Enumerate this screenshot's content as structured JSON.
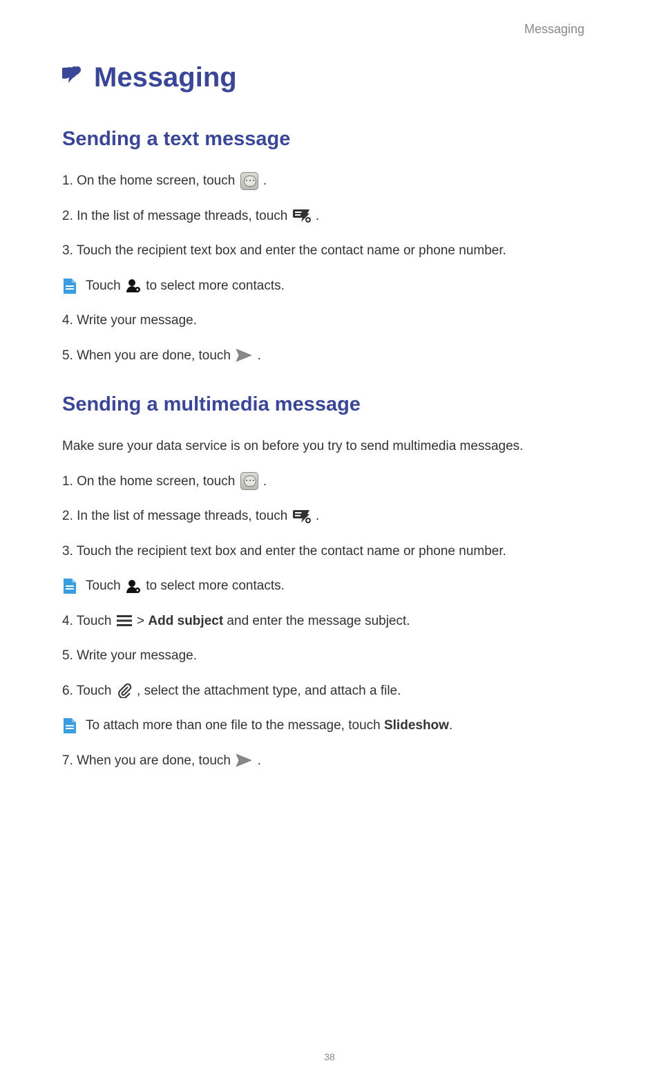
{
  "header": {
    "section_label": "Messaging"
  },
  "chapter": {
    "title": "Messaging"
  },
  "sections": [
    {
      "heading": "Sending a text message",
      "items": [
        {
          "num": "1. ",
          "before": "On the home screen, touch ",
          "icon": "messaging-app",
          "after": "."
        },
        {
          "num": "2. ",
          "before": "In the list of message threads, touch ",
          "icon": "compose-message",
          "after": "."
        },
        {
          "num": "3. ",
          "text": "Touch the recipient text box and enter the contact name or phone number."
        },
        {
          "tip": true,
          "before": "Touch ",
          "icon": "add-contact",
          "after": "to select more contacts."
        },
        {
          "num": "4. ",
          "text": "Write your message."
        },
        {
          "num": "5. ",
          "before": "When you are done, touch ",
          "icon": "send",
          "after": "."
        }
      ]
    },
    {
      "heading": "Sending a multimedia message",
      "intro": "Make sure your data service is on before you try to send multimedia messages.",
      "items": [
        {
          "num": "1. ",
          "before": "On the home screen, touch ",
          "icon": "messaging-app",
          "after": "."
        },
        {
          "num": "2. ",
          "before": "In the list of message threads, touch ",
          "icon": "compose-message",
          "after": "."
        },
        {
          "num": "3. ",
          "text": "Touch the recipient text box and enter the contact name or phone number."
        },
        {
          "tip": true,
          "before": "Touch ",
          "icon": "add-contact",
          "after": "to select more contacts."
        },
        {
          "num": "4. ",
          "before": "Touch ",
          "icon": "menu",
          "after_parts": [
            {
              "text": " > "
            },
            {
              "text": "Add subject",
              "bold": true
            },
            {
              "text": " and enter the message subject."
            }
          ]
        },
        {
          "num": "5. ",
          "text": "Write your message."
        },
        {
          "num": "6. ",
          "before": "Touch ",
          "icon": "attach",
          "after": ", select the attachment type, and attach a file."
        },
        {
          "tip": true,
          "text_parts": [
            {
              "text": "To attach more than one file to the message, touch "
            },
            {
              "text": "Slideshow",
              "bold": true
            },
            {
              "text": "."
            }
          ]
        },
        {
          "num": "7. ",
          "before": "When you are done, touch ",
          "icon": "send",
          "after": "."
        }
      ]
    }
  ],
  "page_number": "38"
}
